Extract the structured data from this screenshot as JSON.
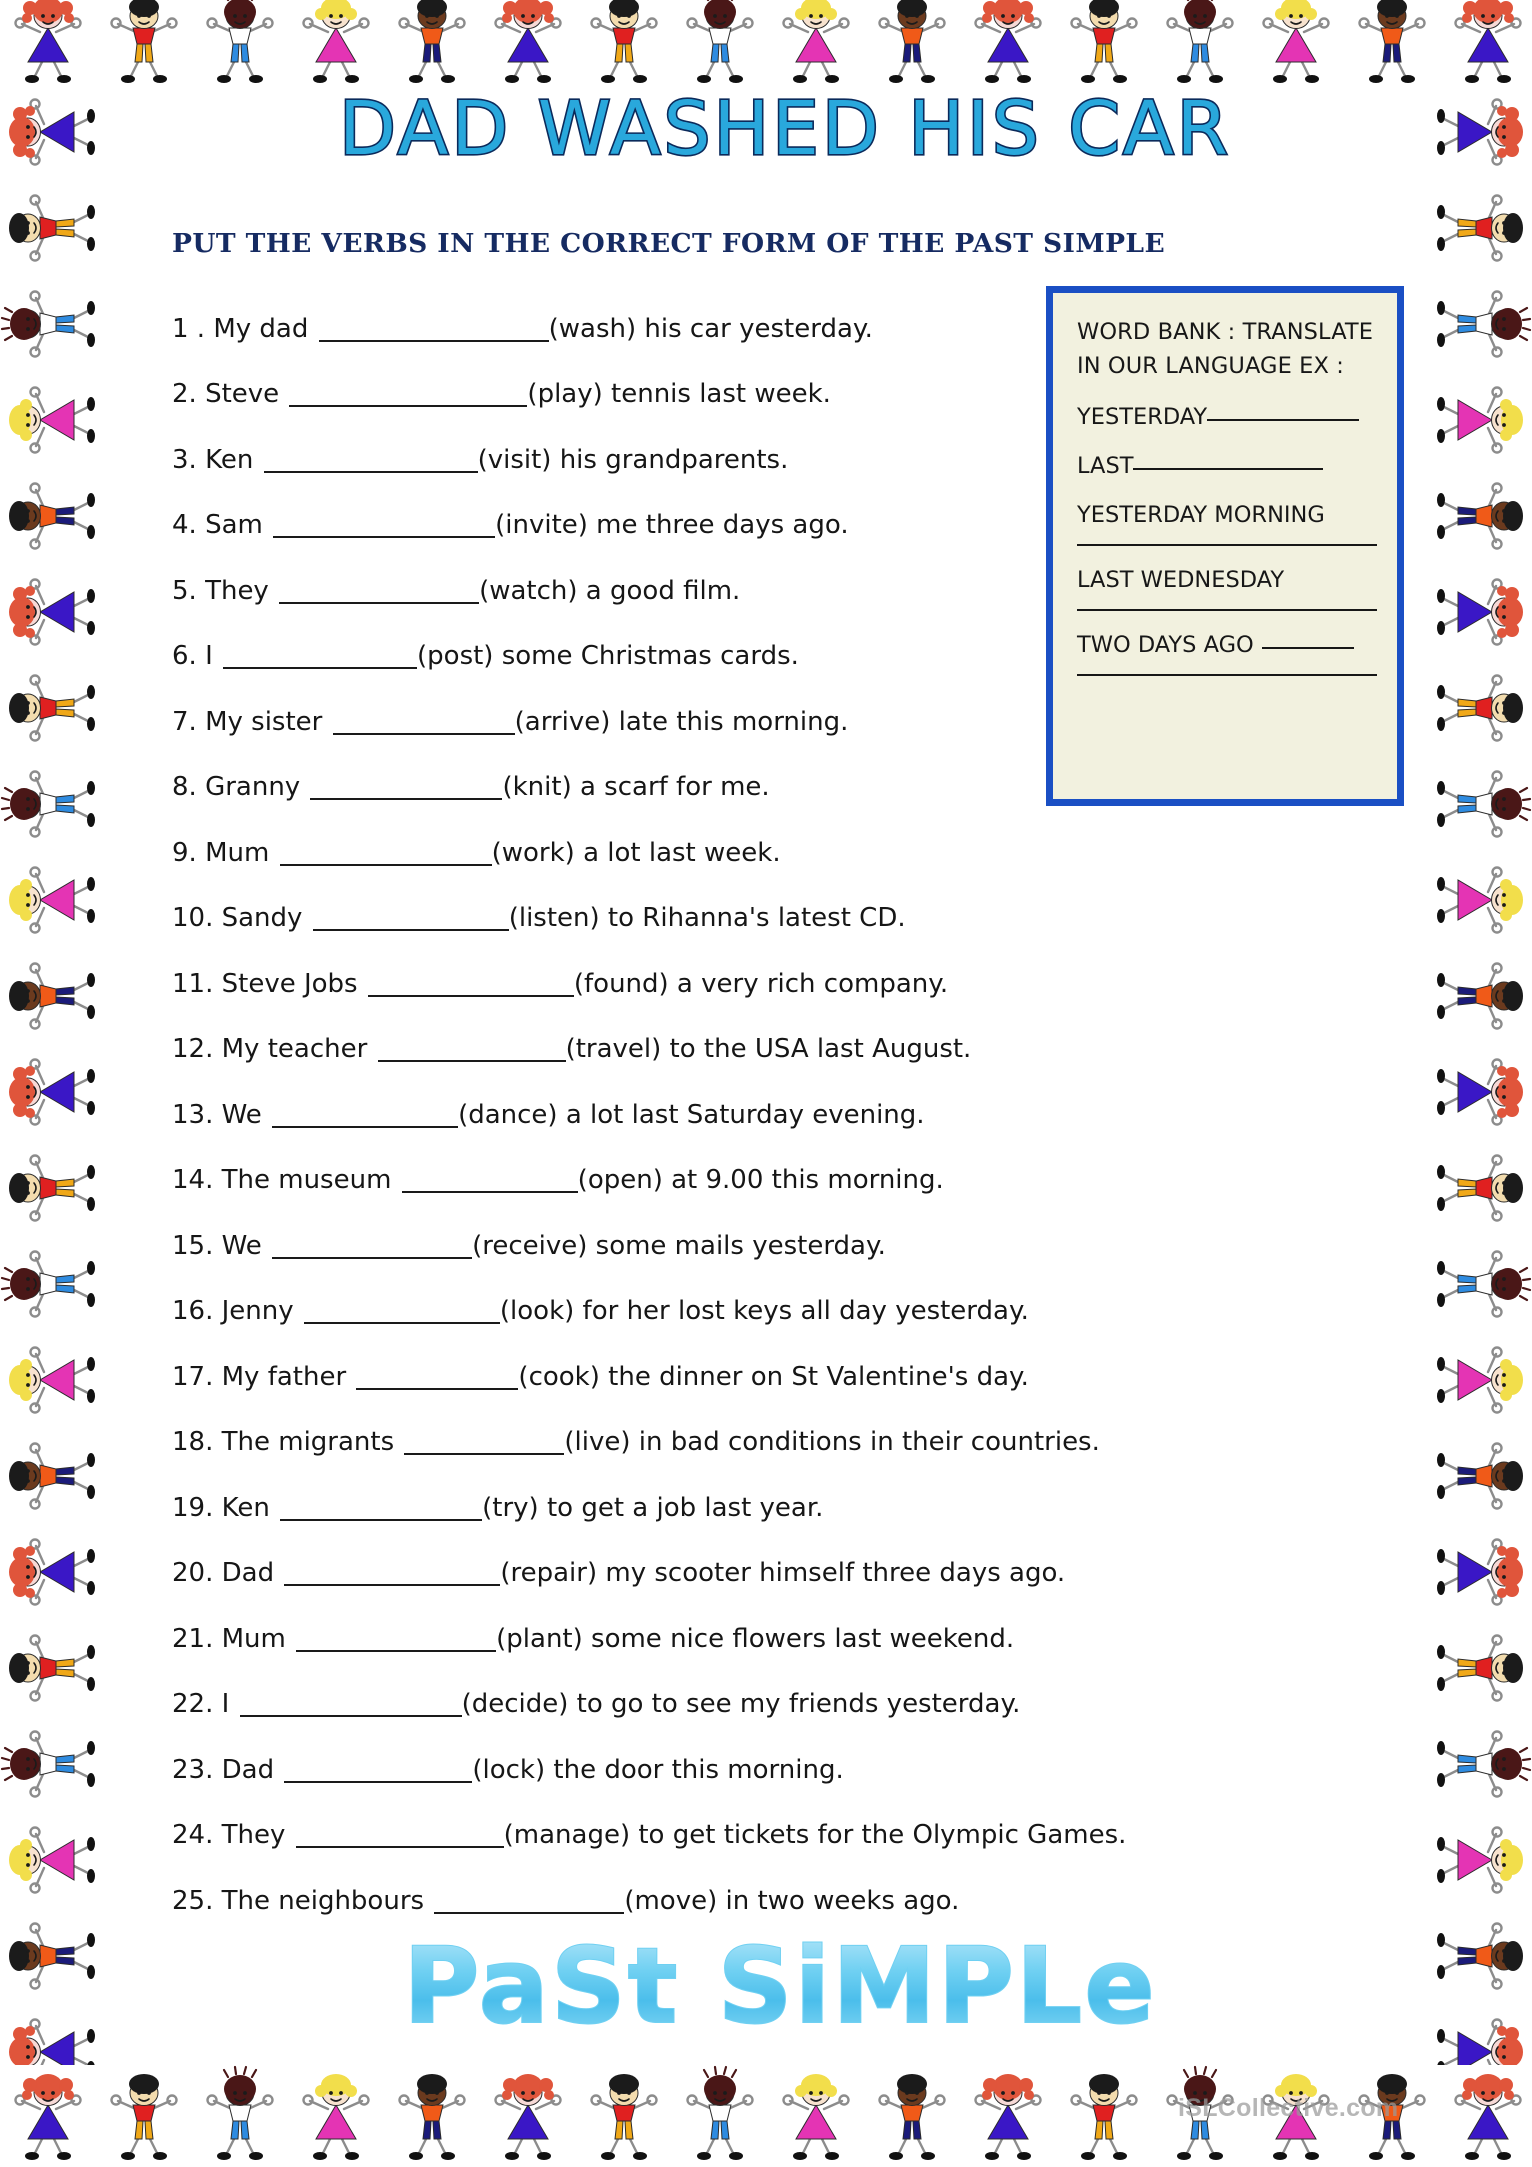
{
  "page": {
    "title": "DAD WASHED HIS CAR",
    "subtitle": "PUT THE VERBS IN THE CORRECT FORM OF THE PAST SIMPLE",
    "footer_word": "PaSt SiMPLe",
    "watermark": "iSLCollective.com",
    "title_color": "#29A8DC",
    "title_outline_color": "#0B2A5B",
    "subtitle_color": "#162B62",
    "footer_word_color": "#5FC7EE",
    "body_text_color": "#161616"
  },
  "exercises": [
    {
      "num": "1 .",
      "subject": "My dad",
      "blank_width": 230,
      "rest": "(wash) his car yesterday."
    },
    {
      "num": "2.",
      "subject": "Steve",
      "blank_width": 238,
      "rest": "(play) tennis last week."
    },
    {
      "num": "3.",
      "subject": "Ken",
      "blank_width": 214,
      "rest": "(visit) his grandparents."
    },
    {
      "num": "4.",
      "subject": "Sam",
      "blank_width": 222,
      "rest": "(invite) me three days ago."
    },
    {
      "num": "5.",
      "subject": "They",
      "blank_width": 200,
      "rest": "(watch) a good film."
    },
    {
      "num": "6.",
      "subject": "I",
      "blank_width": 194,
      "rest": "(post) some Christmas cards."
    },
    {
      "num": "7.",
      "subject": "My sister",
      "blank_width": 182,
      "rest": "(arrive) late this morning."
    },
    {
      "num": "8.",
      "subject": "Granny",
      "blank_width": 192,
      "rest": "(knit) a scarf for me."
    },
    {
      "num": "9.",
      "subject": "Mum",
      "blank_width": 212,
      "rest": " (work) a lot last week."
    },
    {
      "num": "10.",
      "subject": "Sandy",
      "blank_width": 196,
      "rest": "(listen) to Rihanna's latest CD."
    },
    {
      "num": "11.",
      "subject": "Steve Jobs",
      "blank_width": 206,
      "rest": "(found) a very rich company."
    },
    {
      "num": "12.",
      "subject": "My teacher",
      "blank_width": 188,
      "rest": "(travel) to the USA last August."
    },
    {
      "num": "13.",
      "subject": "We",
      "blank_width": 186,
      "rest": "(dance) a lot last Saturday evening."
    },
    {
      "num": "14.",
      "subject": "The museum",
      "blank_width": 176,
      "rest": "(open) at 9.00 this morning."
    },
    {
      "num": "15.",
      "subject": "We",
      "blank_width": 200,
      "rest": "(receive) some mails yesterday."
    },
    {
      "num": "16.",
      "subject": "Jenny",
      "blank_width": 196,
      "rest": "(look) for her lost keys all day yesterday."
    },
    {
      "num": "17.",
      "subject": "My father",
      "blank_width": 162,
      "rest": "(cook) the dinner on St Valentine's day."
    },
    {
      "num": "18.",
      "subject": "The migrants",
      "blank_width": 160,
      "rest": "(live) in bad conditions in their countries."
    },
    {
      "num": "19.",
      "subject": "Ken",
      "blank_width": 202,
      "rest": "(try) to get a job last year."
    },
    {
      "num": "20.",
      "subject": "Dad",
      "blank_width": 216,
      "rest": "(repair) my scooter himself three days ago."
    },
    {
      "num": "21.",
      "subject": "Mum",
      "blank_width": 200,
      "rest": "(plant) some nice flowers last weekend."
    },
    {
      "num": "22.",
      "subject": "I",
      "blank_width": 222,
      "rest": "(decide) to  go to see my friends yesterday."
    },
    {
      "num": "23.",
      "subject": "Dad",
      "blank_width": 188,
      "rest": "(lock) the door this morning."
    },
    {
      "num": "24.",
      "subject": "They",
      "blank_width": 208,
      "rest": "(manage) to get tickets for the Olympic Games."
    },
    {
      "num": "25.",
      "subject": "The neighbours",
      "blank_width": 190,
      "rest": "(move) in two weeks ago."
    }
  ],
  "word_bank": {
    "heading_line1": "WORD BANK : TRANSLATE",
    "heading_line2": "IN OUR LANGUAGE EX :",
    "entries": [
      {
        "label": "YESTERDAY",
        "inline_rule_width": 152,
        "extra_rule": false
      },
      {
        "label": "LAST",
        "inline_rule_width": 190,
        "extra_rule": false
      },
      {
        "label": "YESTERDAY MORNING",
        "inline_rule_width": 0,
        "extra_rule": true
      },
      {
        "label": "LAST WEDNESDAY",
        "inline_rule_width": 0,
        "extra_rule": true
      },
      {
        "label": "TWO DAYS AGO",
        "inline_rule_width": 92,
        "extra_rule": true
      }
    ],
    "border_color": "#1A4FC4",
    "background_color": "#F2F1DF"
  },
  "border_figures": {
    "cycle": [
      {
        "name": "girl-red-pigtails-blue-dress",
        "hair": "#E0553B",
        "skin": "#F6D9D6",
        "top": "#3A17C6",
        "bottom": "#3A17C6",
        "style": "dress"
      },
      {
        "name": "boy-black-hair-red-shirt",
        "hair": "#1B1B1B",
        "skin": "#F3DCAE",
        "top": "#E02020",
        "bottom": "#F0A818",
        "style": "shorts"
      },
      {
        "name": "child-dark-hair-blue-shorts",
        "hair": "#4A1717",
        "skin": "#4A1717",
        "top": "#FFFFFF",
        "bottom": "#2E8BE0",
        "style": "shorts"
      },
      {
        "name": "girl-blonde-pink-dress",
        "hair": "#F2DE4B",
        "skin": "#F7E2CE",
        "top": "#E434B4",
        "bottom": "#E434B4",
        "style": "dress"
      },
      {
        "name": "boy-dark-skin-orange-shirt",
        "hair": "#1B1B1B",
        "skin": "#6B3A1E",
        "top": "#F05A18",
        "bottom": "#1B1B7A",
        "style": "pants"
      }
    ],
    "count_top": 16,
    "count_bottom": 16,
    "count_side": 21
  }
}
